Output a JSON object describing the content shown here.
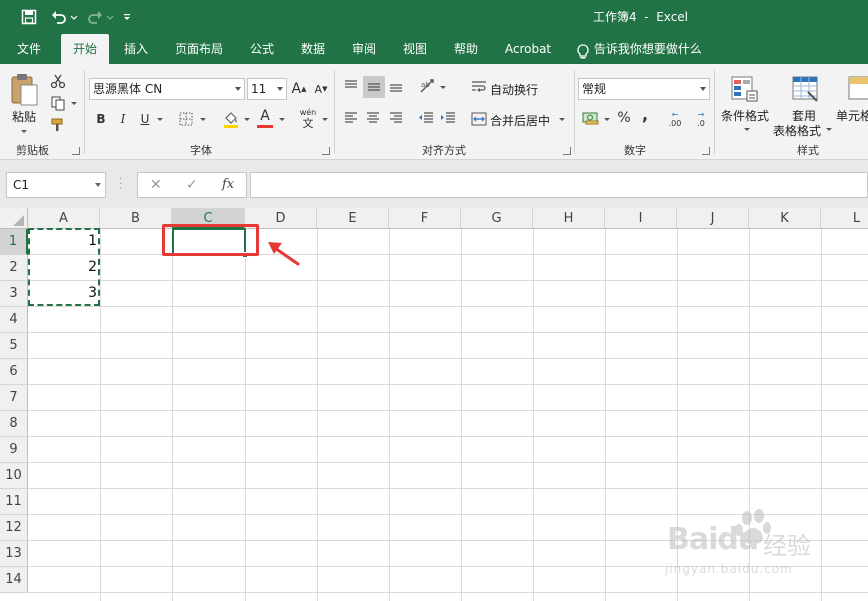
{
  "title_bar": {
    "title": "工作簿4  -  Excel",
    "save_icon": "save-icon",
    "undo_icon": "undo-icon",
    "redo_icon": "redo-icon",
    "customize_icon": "customize-quick-access-icon",
    "background": "#217346"
  },
  "tabs": [
    {
      "label": "文件"
    },
    {
      "label": "开始",
      "active": true
    },
    {
      "label": "插入"
    },
    {
      "label": "页面布局"
    },
    {
      "label": "公式"
    },
    {
      "label": "数据"
    },
    {
      "label": "审阅"
    },
    {
      "label": "视图"
    },
    {
      "label": "帮助"
    },
    {
      "label": "Acrobat"
    },
    {
      "label": "告诉我你想要做什么",
      "icon": "lightbulb-icon"
    }
  ],
  "ribbon": {
    "clipboard": {
      "paste_label": "粘贴",
      "group_label": "剪贴板"
    },
    "font": {
      "font_name": "思源黑体 CN",
      "font_size": "11",
      "bold": "B",
      "italic": "I",
      "underline": "U",
      "font_color_letter": "A",
      "phonetic_top": "wén",
      "phonetic_bottom": "文",
      "grow_label": "A",
      "shrink_label": "A",
      "group_label": "字体",
      "font_color": "#e53935"
    },
    "alignment": {
      "wrap_text": "自动换行",
      "merge_center": "合并后居中",
      "group_label": "对齐方式"
    },
    "number": {
      "format": "常规",
      "percent": "%",
      "comma": ",",
      "inc_decimal": ".00",
      "dec_decimal": ".0",
      "group_label": "数字"
    },
    "styles": {
      "conditional_format": "条件格式",
      "format_table_line1": "套用",
      "format_table_line2": "表格格式",
      "cell_styles": "单元格",
      "group_label": "样式"
    }
  },
  "formula_bar": {
    "name_box": "C1",
    "cancel": "✕",
    "enter": "✓",
    "fx": "fx",
    "value": ""
  },
  "sheet": {
    "columns": [
      "A",
      "B",
      "C",
      "D",
      "E",
      "F",
      "G",
      "H",
      "I",
      "J",
      "K",
      "L"
    ],
    "rows": [
      "1",
      "2",
      "3",
      "4",
      "5",
      "6",
      "7",
      "8",
      "9",
      "10",
      "11",
      "12",
      "13",
      "14"
    ],
    "selected_column": "C",
    "selected_row": "1",
    "cells": [
      {
        "ref": "A1",
        "value": "1"
      },
      {
        "ref": "A2",
        "value": "2"
      },
      {
        "ref": "A3",
        "value": "3"
      }
    ],
    "copy_range": "A1:A3",
    "active_cell": "C1",
    "accent": "#217346",
    "highlight_color": "#e53935"
  },
  "watermark": {
    "brand": "Baidu",
    "suffix": "经验",
    "url": "jingyan.baidu.com"
  }
}
